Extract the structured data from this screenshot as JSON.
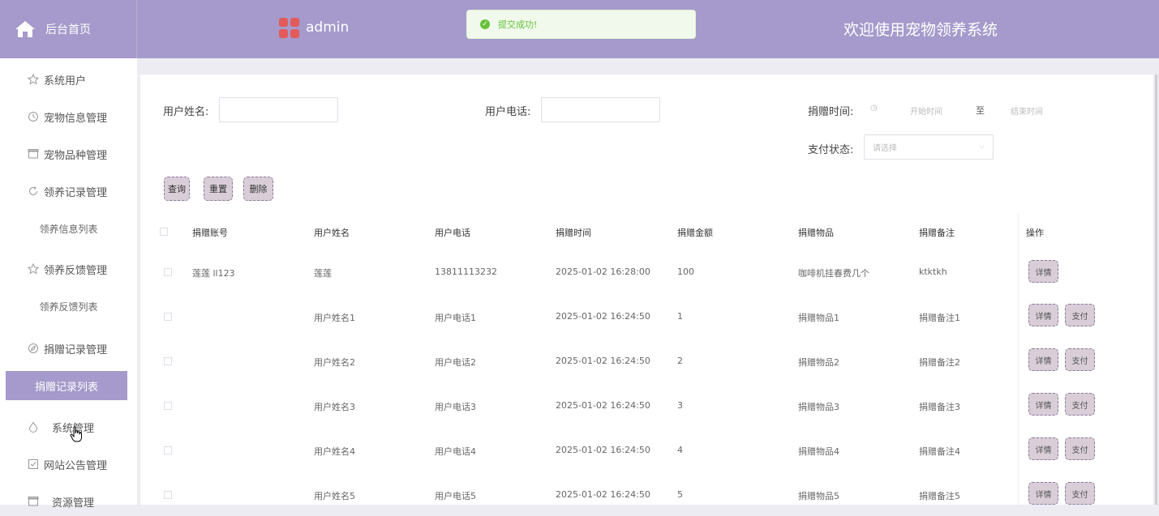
{
  "header": {
    "home_label": "后台首页",
    "admin_name": "admin",
    "toast_text": "提交成功!",
    "welcome": "欢迎使用宠物领养系统",
    "colors": {
      "primary": "#a59acb",
      "toast_bg": "#f0f9eb",
      "toast_text": "#67c23a",
      "logo_red": "#e35a5a"
    }
  },
  "sidebar": {
    "items": [
      {
        "label": "系统用户",
        "icon": "star-icon"
      },
      {
        "label": "宠物信息管理",
        "icon": "clock-icon"
      },
      {
        "label": "宠物品种管理",
        "icon": "box-icon"
      },
      {
        "label": "领养记录管理",
        "icon": "refresh-icon"
      },
      {
        "label": "领养信息列表",
        "icon": ""
      },
      {
        "label": "领养反馈管理",
        "icon": "star-icon"
      },
      {
        "label": "领养反馈列表",
        "icon": ""
      },
      {
        "label": "捐赠记录管理",
        "icon": "compass-icon"
      },
      {
        "label": "捐赠记录列表",
        "icon": ""
      },
      {
        "label": "系统管理",
        "icon": "drop-icon"
      },
      {
        "label": "网站公告管理",
        "icon": "checkbox-icon"
      },
      {
        "label": "资源管理",
        "icon": "box-icon"
      }
    ],
    "active_index": 8
  },
  "filters": {
    "user_name_label": "用户姓名:",
    "user_phone_label": "用户电话:",
    "donation_time_label": "捐赠时间:",
    "start_placeholder": "开始时间",
    "range_sep": "至",
    "end_placeholder": "结束时间",
    "pay_status_label": "支付状态:",
    "pay_status_placeholder": "请选择"
  },
  "buttons": {
    "query": "查询",
    "reset": "重置",
    "delete": "删除"
  },
  "table": {
    "headers": [
      "捐赠账号",
      "用户姓名",
      "用户电话",
      "捐赠时间",
      "捐赠金额",
      "捐赠物品",
      "捐赠备注",
      "操作"
    ],
    "rows": [
      {
        "account": "莲莲 ll123",
        "name": "莲莲",
        "phone": "13811113232",
        "time": "2025-01-02 16:28:00",
        "amount": "100",
        "item": "咖啡机挂春费几个",
        "remark": "ktktkh",
        "has_pay": false
      },
      {
        "account": "",
        "name": "用户姓名1",
        "phone": "用户电话1",
        "time": "2025-01-02 16:24:50",
        "amount": "1",
        "item": "捐赠物品1",
        "remark": "捐赠备注1",
        "has_pay": true
      },
      {
        "account": "",
        "name": "用户姓名2",
        "phone": "用户电话2",
        "time": "2025-01-02 16:24:50",
        "amount": "2",
        "item": "捐赠物品2",
        "remark": "捐赠备注2",
        "has_pay": true
      },
      {
        "account": "",
        "name": "用户姓名3",
        "phone": "用户电话3",
        "time": "2025-01-02 16:24:50",
        "amount": "3",
        "item": "捐赠物品3",
        "remark": "捐赠备注3",
        "has_pay": true
      },
      {
        "account": "",
        "name": "用户姓名4",
        "phone": "用户电话4",
        "time": "2025-01-02 16:24:50",
        "amount": "4",
        "item": "捐赠物品4",
        "remark": "捐赠备注4",
        "has_pay": true
      },
      {
        "account": "",
        "name": "用户姓名5",
        "phone": "用户电话5",
        "time": "2025-01-02 16:24:50",
        "amount": "5",
        "item": "捐赠物品5",
        "remark": "捐赠备注5",
        "has_pay": true
      }
    ],
    "detail_label": "详情",
    "pay_label": "支付"
  }
}
